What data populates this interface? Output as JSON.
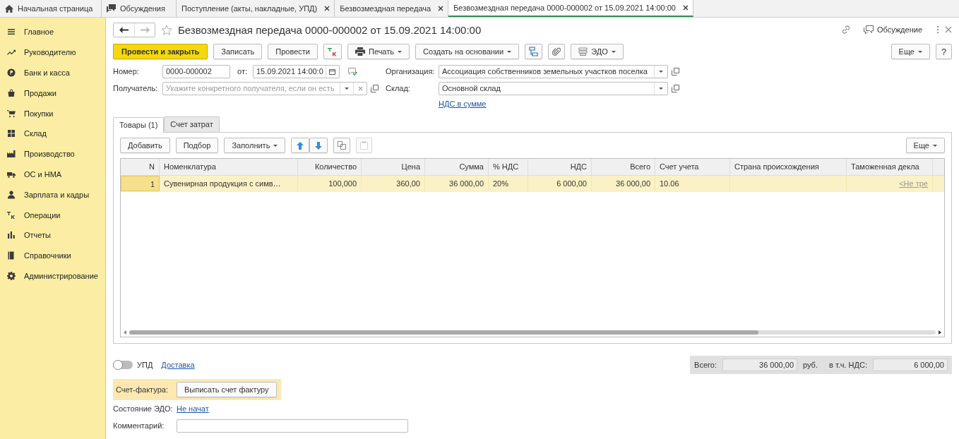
{
  "tabs": [
    {
      "kind": "home",
      "label": "Начальная страница",
      "selected": false
    },
    {
      "kind": "discussion",
      "label": "Обсуждения",
      "selected": false
    },
    {
      "kind": "doc",
      "label": "Поступление (акты, накладные, УПД)",
      "selected": false
    },
    {
      "kind": "doc",
      "label": "Безвозмездная передача",
      "selected": false
    },
    {
      "kind": "doc",
      "label": "Безвозмездная передача 0000-000002 от 15.09.2021 14:00:00",
      "selected": true
    }
  ],
  "sidebar": {
    "items": [
      {
        "label": "Главное"
      },
      {
        "label": "Руководителю"
      },
      {
        "label": "Банк и касса"
      },
      {
        "label": "Продажи"
      },
      {
        "label": "Покупки"
      },
      {
        "label": "Склад"
      },
      {
        "label": "Производство"
      },
      {
        "label": "ОС и НМА"
      },
      {
        "label": "Зарплата и кадры"
      },
      {
        "label": "Операции"
      },
      {
        "label": "Отчеты"
      },
      {
        "label": "Справочники"
      },
      {
        "label": "Администрирование"
      }
    ]
  },
  "form": {
    "title": "Безвозмездная передача 0000-000002 от 15.09.2021 14:00:00",
    "discussion": "Обсуждение",
    "toolbar": {
      "post_close": "Провести и закрыть",
      "save": "Записать",
      "post": "Провести",
      "print": "Печать",
      "create_based": "Создать на основании",
      "edo": "ЭДО",
      "more": "Еще",
      "help": "?"
    },
    "number": {
      "label": "Номер:",
      "value": "0000-000002"
    },
    "date": {
      "label": "от:",
      "value": "15.09.2021 14:00:0"
    },
    "recipient": {
      "label": "Получатель:",
      "placeholder": "Укажите конкретного получателя, если он есть"
    },
    "organization": {
      "label": "Организация:",
      "value": "Ассоциация собственников земельных участков поселка"
    },
    "warehouse": {
      "label": "Склад:",
      "value": "Основной склад"
    },
    "vat_link": "НДС в сумме",
    "inner_tabs": [
      {
        "label": "Товары (1)",
        "selected": true
      },
      {
        "label": "Счет затрат",
        "selected": false
      }
    ],
    "table_toolbar": {
      "add": "Добавить",
      "pick": "Подбор",
      "fill": "Заполнить",
      "more": "Еще"
    },
    "table": {
      "columns": [
        {
          "label": "N",
          "kind": "number"
        },
        {
          "label": "Номенклатура",
          "kind": "text"
        },
        {
          "label": "Количество",
          "kind": "number"
        },
        {
          "label": "Цена",
          "kind": "number"
        },
        {
          "label": "Сумма",
          "kind": "number"
        },
        {
          "label": "% НДС",
          "kind": "text"
        },
        {
          "label": "НДС",
          "kind": "number"
        },
        {
          "label": "Всего",
          "kind": "number"
        },
        {
          "label": "Счет учета",
          "kind": "text"
        },
        {
          "label": "Страна происхождения",
          "kind": "text"
        },
        {
          "label": "Таможенная декла",
          "kind": "link"
        }
      ],
      "rows": [
        {
          "selected": true,
          "cells": [
            "1",
            "Сувенирная продукция с симв…",
            "100,000",
            "360,00",
            "36 000,00",
            "20%",
            "6 000,00",
            "36 000,00",
            "10.06",
            "",
            "<Не тре"
          ]
        }
      ]
    },
    "upd": {
      "label": "УПД",
      "on": false
    },
    "delivery_link": "Доставка",
    "totals": {
      "total_label": "Всего:",
      "total_value": "36 000,00",
      "currency": "руб.",
      "vat_label": "в т.ч. НДС:",
      "vat_value": "6 000,00"
    },
    "invoice": {
      "label": "Счет-фактура:",
      "button": "Выписать счет фактуру"
    },
    "edo_state": {
      "label": "Состояние ЭДО:",
      "link": "Не начат"
    },
    "comment": {
      "label": "Комментарий:"
    }
  }
}
